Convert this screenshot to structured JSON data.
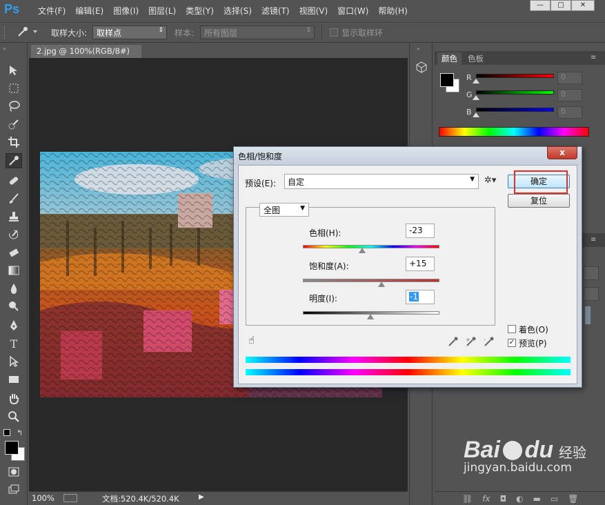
{
  "app": {
    "logo": "Ps"
  },
  "menu": [
    "文件(F)",
    "编辑(E)",
    "图像(I)",
    "图层(L)",
    "类型(Y)",
    "选择(S)",
    "滤镜(T)",
    "视图(V)",
    "窗口(W)",
    "帮助(H)"
  ],
  "window_controls": {
    "minimize": "—",
    "restore": "□",
    "close": "✕"
  },
  "options_bar": {
    "sample_size_label": "取样大小:",
    "sample_size_value": "取样点",
    "sample_label": "样本:",
    "sample_value": "所有图层",
    "show_ring_label": "显示取样环"
  },
  "document": {
    "tab_title": "2.jpg @ 100%(RGB/8#) *",
    "tab_close": "×"
  },
  "status": {
    "zoom": "100%",
    "doc_info": "文档:520.4K/520.4K"
  },
  "color_panel": {
    "tabs": [
      "颜色",
      "色板"
    ],
    "channels": [
      {
        "name": "R",
        "value": "0",
        "color": "#d01010"
      },
      {
        "name": "G",
        "value": "0",
        "color": "#10c010"
      },
      {
        "name": "B",
        "value": "0",
        "color": "#1010d0"
      }
    ]
  },
  "dialog": {
    "title": "色相/饱和度",
    "close_label": "x",
    "preset_label": "预设(E):",
    "preset_value": "自定",
    "ok_label": "确定",
    "reset_label": "复位",
    "range_value": "全图",
    "hue_label": "色相(H):",
    "hue_value": "-23",
    "sat_label": "饱和度(A):",
    "sat_value": "+15",
    "light_label": "明度(I):",
    "light_value": "-1",
    "colorize_label": "着色(O)",
    "colorize_checked": false,
    "preview_label": "预览(P)",
    "preview_checked": true
  },
  "watermark": {
    "brand": "Bai",
    "brand2": "du",
    "brand_cn": "经验",
    "url": "jingyan.baidu.com"
  }
}
